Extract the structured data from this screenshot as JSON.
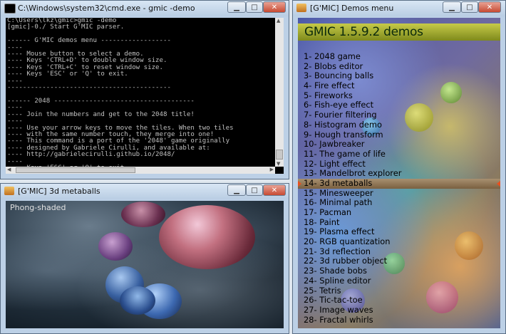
{
  "cmd_window": {
    "title": "C:\\Windows\\system32\\cmd.exe - gmic  -demo",
    "lines": [
      "C:\\Users\\lkz\\gmic>gmic -demo",
      "[gmic]-0./ Start G'MIC parser.",
      "",
      "------ G'MIC demos menu ------------------",
      "----",
      "---- Mouse button to select a demo.",
      "---- Keys 'CTRL+D' to double window size.",
      "---- Keys 'CTRL+C' to reset window size.",
      "---- Keys 'ESC' or 'Q' to exit.",
      "----",
      "------------------------------------------",
      "",
      "------ 2048 ------------------------------------",
      "----",
      "---- Join the numbers and get to the 2048 title!",
      "----",
      "---- Use your arrow keys to move the tiles. When two tiles",
      "---- with the same number touch, they merge into one!",
      "---- This command is a port of the '2048' game originally",
      "---- designed by Gabriele Cirulli, and available at:",
      "---- http://gabrielecirulli.github.io/2048/",
      "----",
      "---- Keys 'ESC' or 'Q' to exit."
    ]
  },
  "metaballs_window": {
    "title": "[G'MIC] 3d metaballs",
    "label": "Phong-shaded"
  },
  "demos_window": {
    "title": "[G'MIC] Demos menu",
    "header": "GMIC 1.5.9.2 demos",
    "selected_index": 13,
    "items": [
      "1- 2048 game",
      "2- Blobs editor",
      "3- Bouncing balls",
      "4- Fire effect",
      "5- Fireworks",
      "6- Fish-eye effect",
      "7- Fourier filtering",
      "8- Histogram demo",
      "9- Hough transform",
      "10- Jawbreaker",
      "11- The game of life",
      "12- Light effect",
      "13- Mandelbrot explorer",
      "14- 3d metaballs",
      "15- Minesweeper",
      "16- Minimal path",
      "17- Pacman",
      "18- Paint",
      "19- Plasma effect",
      "20- RGB quantization",
      "21- 3d reflection",
      "22- 3d rubber object",
      "23- Shade bobs",
      "24- Spline editor",
      "25- Tetris",
      "26- Tic-tac-toe",
      "27- Image waves",
      "28- Fractal whirls"
    ]
  },
  "icons": {
    "minimize": "minimize-icon",
    "maximize": "maximize-icon",
    "close": "close-icon"
  },
  "colors": {
    "close_button": "#c74a32",
    "header": "#a8b030",
    "selection": "#94795a"
  }
}
